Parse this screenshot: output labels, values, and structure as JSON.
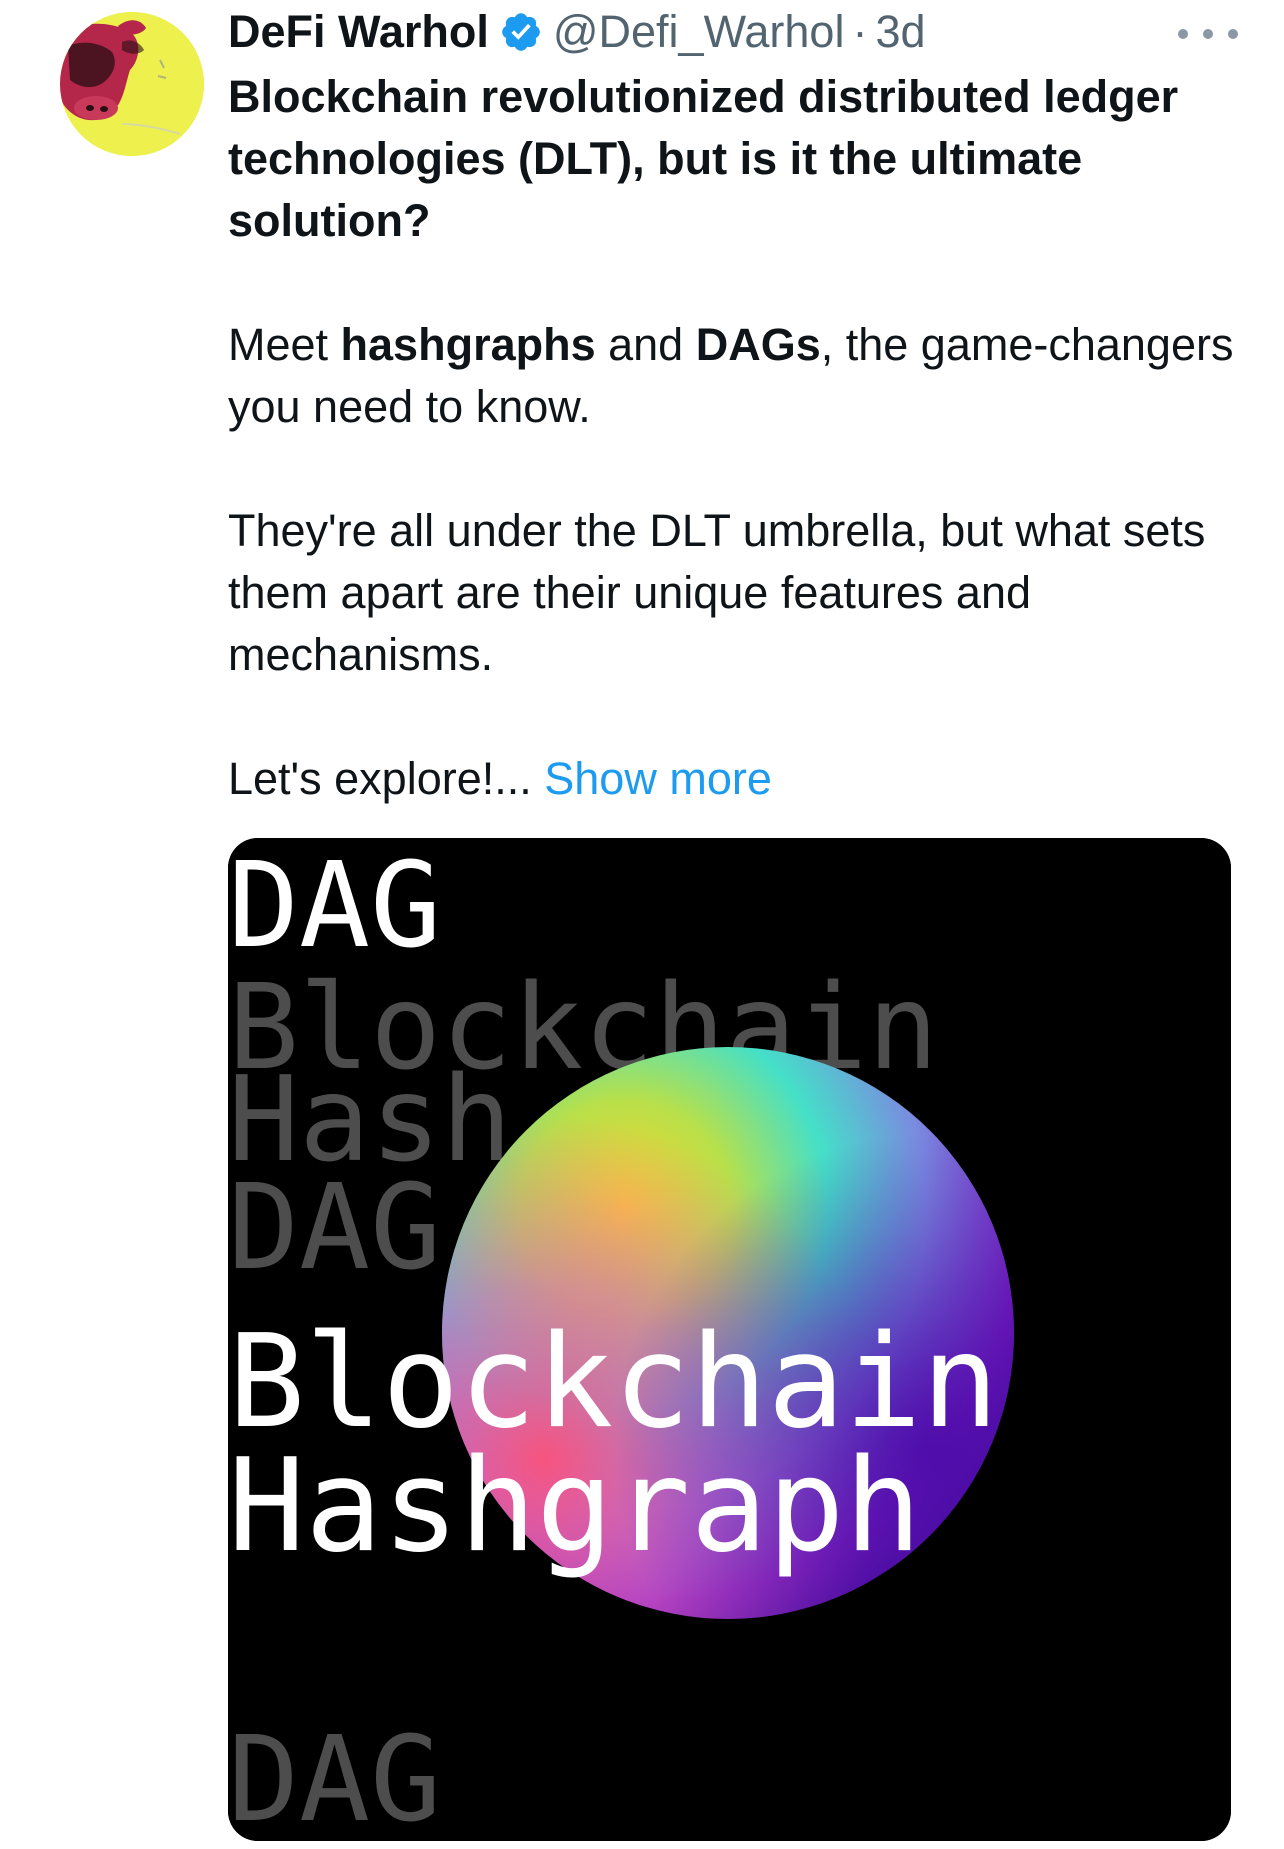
{
  "author": {
    "name": "DeFi Warhol",
    "handle": "@Defi_Warhol",
    "separator": "·",
    "time": "3d"
  },
  "icons": {
    "verified": "verified-badge-icon",
    "more": "more-options-icon"
  },
  "tweet": {
    "headline": "Blockchain revolutionized distributed ledger technologies (DLT), but is it the ultimate solution?",
    "p1_a": "Meet ",
    "p1_bold1": "hashgraphs",
    "p1_b": " and ",
    "p1_bold2": "DAGs",
    "p1_c": ", the game-changers you need to know.",
    "p2": "They're all under the DLT umbrella, but what sets them apart are their unique features and mechanisms.",
    "p3": "Let's explore!...",
    "show_more": "Show more"
  },
  "media": {
    "lines": [
      {
        "text": "DAG",
        "tone": "bright"
      },
      {
        "text": "Blockchain",
        "tone": "dim"
      },
      {
        "text": "Hash",
        "tone": "dim"
      },
      {
        "text": "DAG",
        "tone": "dim"
      },
      {
        "text": "Blockchain",
        "tone": "bright"
      },
      {
        "text": "Hashgraph",
        "tone": "bright"
      },
      {
        "text": "DAG",
        "tone": "dim"
      }
    ]
  },
  "colors": {
    "link": "#1d9bf0",
    "verified": "#1d9bf0",
    "secondary_text": "#536471",
    "media_background": "#000000",
    "avatar_background": "#eef04e"
  }
}
